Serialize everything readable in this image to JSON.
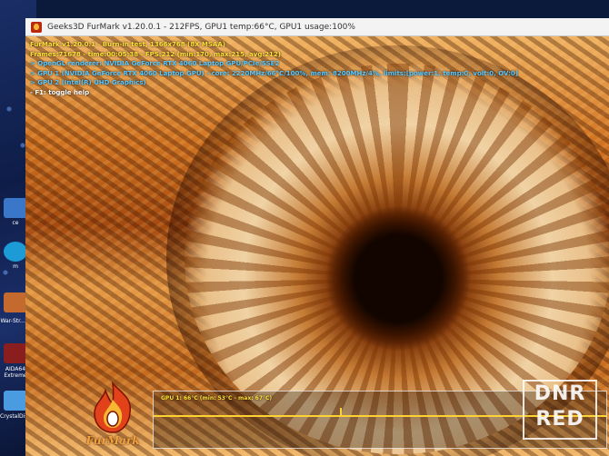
{
  "desktop": {
    "icons": [
      {
        "label": "ce",
        "color": "#3a77c8"
      },
      {
        "label": "m",
        "color": "#1c9bd6"
      },
      {
        "label": "War-Str... 2",
        "color": "#c46a2e"
      },
      {
        "label": "AIDA64 Extreme",
        "color": "#8a1d1d"
      },
      {
        "label": "CrystalDisk...",
        "color": "#4b9be0"
      }
    ]
  },
  "window": {
    "title": "Geeks3D FurMark v1.20.0.1 - 212FPS, GPU1 temp:66°C, GPU1 usage:100%"
  },
  "osd": {
    "title": "FurMark v1.20.0.1 - Burn-in test, 1366x768 (8X MSAA)",
    "frames": "Frames:71678 - time:00:05:38 - FPS:212 (min:170, max:215, avg:212)",
    "renderer": "> OpenGL renderer: NVIDIA GeForce RTX 4060 Laptop GPU/PCIe/SSE2",
    "gpu1": "> GPU 1 (NVIDIA GeForce RTX 4060 Laptop GPU) - core: 2220MHz/66°C/100%, mem: 8200MHz/4%, limits:[power:1, temp:0, volt:0, OV:0]",
    "gpu2": "> GPU 2 (Intel(R) UHD Graphics)",
    "help": "- F1: toggle help"
  },
  "graph": {
    "label": "GPU 1: 66°C (min: 53°C - max: 67°C)"
  },
  "logo": {
    "text": "FurMark"
  },
  "watermark": {
    "line1": "DNR",
    "line2": "RED"
  }
}
